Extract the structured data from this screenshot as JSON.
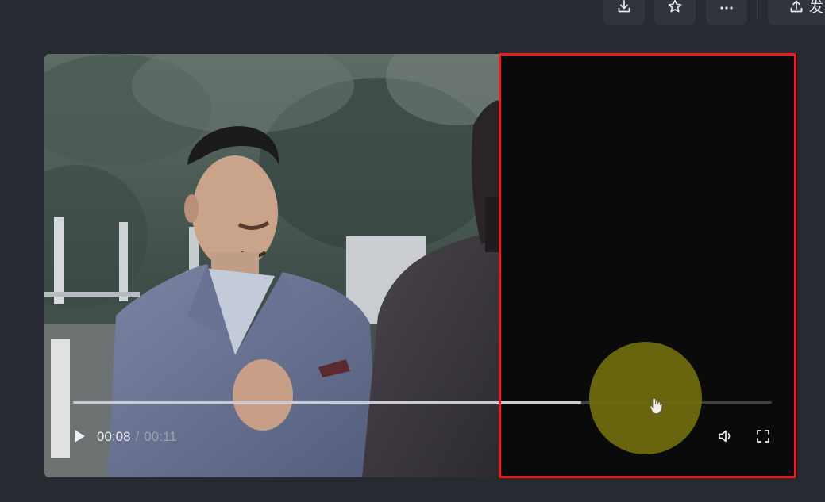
{
  "toolbar": {
    "download_icon": "download-icon",
    "favorite_icon": "star-icon",
    "more_icon": "more-horizontal-icon",
    "publish_icon": "upload-icon",
    "publish_label": "发"
  },
  "player": {
    "current_time": "00:08",
    "separator": "/",
    "duration": "00:11",
    "progress_fraction": 0.727,
    "play_icon": "play-icon",
    "volume_icon": "volume-icon",
    "fullscreen_icon": "fullscreen-icon",
    "video_description": "scene-two-men-in-suits-outdoors"
  },
  "colors": {
    "background": "#272a31",
    "highlight_border": "#ee1c1c",
    "cursor_halo": "#6e6a0f"
  }
}
